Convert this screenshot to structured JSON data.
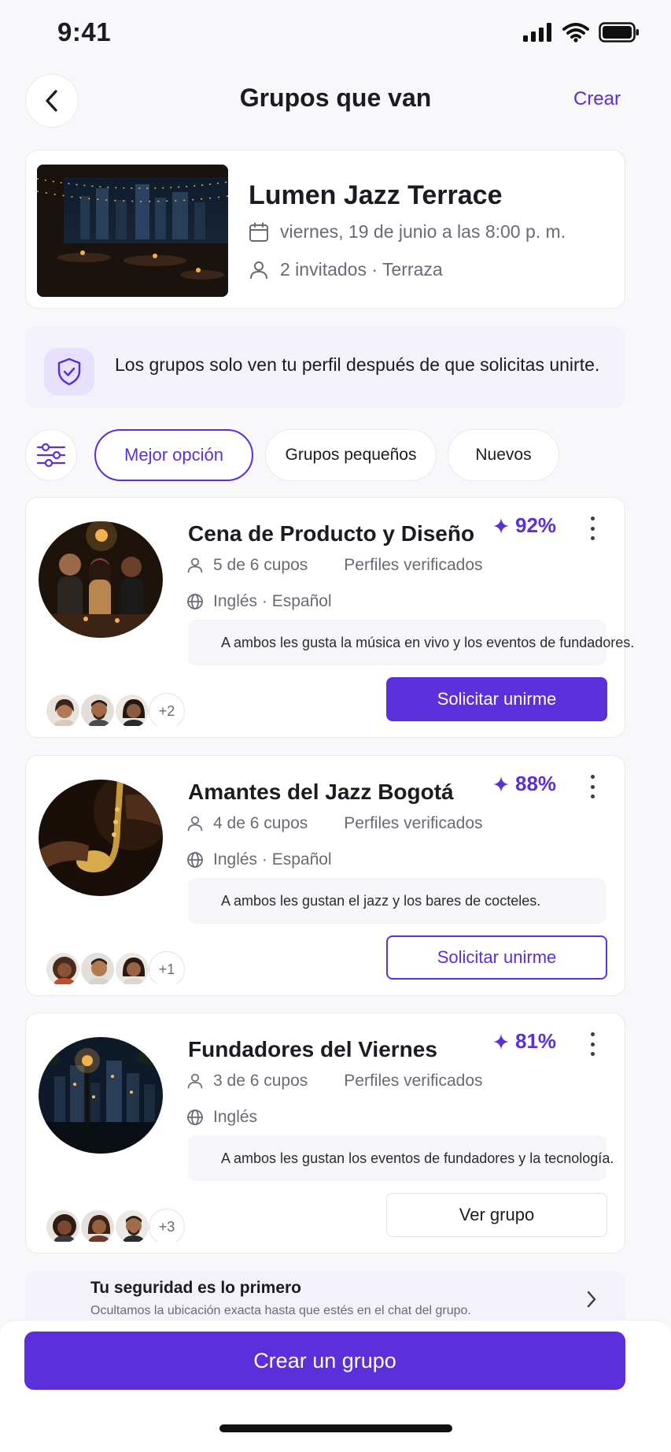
{
  "status_bar": {
    "time": "9:41"
  },
  "header": {
    "title": "Grupos que van",
    "create_label": "Crear"
  },
  "event": {
    "title": "Lumen Jazz Terrace",
    "date": "viernes, 19 de junio a las 8:00 p. m.",
    "guests": "2 invitados · Terraza"
  },
  "notice": {
    "text": "Los grupos solo ven tu perfil después de que solicitas unirte."
  },
  "filters": {
    "chips": [
      {
        "label": "Mejor opción",
        "active": true
      },
      {
        "label": "Grupos pequeños",
        "active": false
      },
      {
        "label": "Nuevos",
        "active": false
      }
    ]
  },
  "groups": [
    {
      "title": "Cena de Producto y Diseño",
      "match": "92%",
      "spots": "5 de 6 cupos",
      "verified": "Perfiles verificados",
      "languages": "Inglés · Español",
      "note": "A ambos les gusta la música en vivo y los eventos de fundadores.",
      "extra_members": "+2",
      "button_label": "Solicitar unirme",
      "button_style": "primary"
    },
    {
      "title": "Amantes del Jazz Bogotá",
      "match": "88%",
      "spots": "4 de 6 cupos",
      "verified": "Perfiles verificados",
      "languages": "Inglés · Español",
      "note": "A ambos les gustan el jazz y los bares de cocteles.",
      "extra_members": "+1",
      "button_label": "Solicitar unirme",
      "button_style": "outline"
    },
    {
      "title": "Fundadores del Viernes",
      "match": "81%",
      "spots": "3 de 6 cupos",
      "verified": "Perfiles verificados",
      "languages": "Inglés",
      "note": "A ambos les gustan los eventos de fundadores y la tecnología.",
      "extra_members": "+3",
      "button_label": "Ver grupo",
      "button_style": "ghost"
    }
  ],
  "safety": {
    "title": "Tu seguridad es lo primero",
    "subtitle": "Ocultamos la ubicación exacta hasta que estés en el chat del grupo."
  },
  "cta": {
    "label": "Crear un grupo"
  },
  "colors": {
    "accent": "#5b2fd9",
    "background": "#f8f7fa",
    "card": "#ffffff"
  },
  "icons": [
    "back-arrow-icon",
    "calendar-icon",
    "person-icon",
    "shield-check-icon",
    "sliders-icon",
    "sparkle-icon",
    "more-vertical-icon",
    "globe-icon",
    "chevron-right-icon"
  ]
}
